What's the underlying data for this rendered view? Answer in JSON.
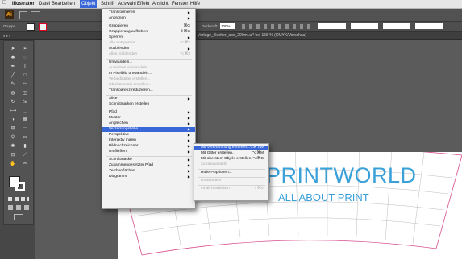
{
  "menubar": {
    "apple": "",
    "items": [
      "Illustrator",
      "Datei",
      "Bearbeiten",
      "Objekt",
      "Schrift",
      "Auswahl",
      "Effekt",
      "Ansicht",
      "Fenster",
      "Hilfe"
    ],
    "active": "Objekt"
  },
  "app": {
    "logo": "Ai"
  },
  "control": {
    "left_label": "Gruppe",
    "deckkraft_label": "Deckkraft:",
    "deckkraft_value": "100%"
  },
  "document_tab": {
    "title": "Vorlage_Becher_abc_290ml.ai* bei 158 % (CMYK/Vorschau)"
  },
  "objekt_menu": [
    {
      "label": "Transformieren",
      "submenu": true
    },
    {
      "label": "Anordnen",
      "submenu": true
    },
    {
      "sep": true
    },
    {
      "label": "Gruppieren",
      "shortcut": "⌘G"
    },
    {
      "label": "Gruppierung aufheben",
      "shortcut": "⇧⌘G"
    },
    {
      "label": "Sperren",
      "submenu": true
    },
    {
      "label": "Alle entsperren",
      "shortcut": "⌥⌘2",
      "disabled": true
    },
    {
      "label": "Ausblenden",
      "submenu": true
    },
    {
      "label": "Alles einblenden",
      "shortcut": "⌥⌘3",
      "disabled": true
    },
    {
      "sep": true
    },
    {
      "label": "Umwandeln..."
    },
    {
      "label": "Aussehen umwandeln",
      "disabled": true
    },
    {
      "label": "In Pixelbild umwandeln..."
    },
    {
      "label": "Verlaufsgitter erstellen...",
      "disabled": true
    },
    {
      "label": "Objektmosaik erstellen...",
      "disabled": true
    },
    {
      "label": "Transparenz reduzieren..."
    },
    {
      "sep": true
    },
    {
      "label": "Slice",
      "submenu": true
    },
    {
      "label": "Schnittmarken erstellen"
    },
    {
      "sep": true
    },
    {
      "label": "Pfad",
      "submenu": true
    },
    {
      "label": "Muster",
      "submenu": true
    },
    {
      "label": "Angleichen",
      "submenu": true
    },
    {
      "label": "Verzerrungshülle",
      "submenu": true,
      "highlight": true
    },
    {
      "label": "Perspektive",
      "submenu": true
    },
    {
      "label": "Interaktiv malen",
      "submenu": true
    },
    {
      "label": "Bildnachzeichner",
      "submenu": true
    },
    {
      "label": "Umfließen",
      "submenu": true
    },
    {
      "sep": true
    },
    {
      "label": "Schnittmaske",
      "submenu": true
    },
    {
      "label": "Zusammengesetzter Pfad",
      "submenu": true
    },
    {
      "label": "Zeichenflächen",
      "submenu": true
    },
    {
      "label": "Diagramm",
      "submenu": true
    }
  ],
  "huelle_submenu": [
    {
      "label": "Mit Verkrümmung erstellen...",
      "shortcut": "⌥⌘⇧W",
      "highlight": true
    },
    {
      "label": "Mit Gitter erstellen...",
      "shortcut": "⌥⌘M"
    },
    {
      "label": "Mit oberstem Objekt erstellen",
      "shortcut": "⌥⌘C"
    },
    {
      "label": "Zurückwandeln",
      "disabled": true
    },
    {
      "sep": true
    },
    {
      "label": "Hüllen-Optionen..."
    },
    {
      "sep": true
    },
    {
      "label": "Umwandeln",
      "disabled": true
    },
    {
      "sep": true
    },
    {
      "label": "Inhalt bearbeiten",
      "shortcut": "⇧⌘V",
      "disabled": true
    }
  ],
  "artwork": {
    "text_main": "PRINTWORLD",
    "text_sub": "ALL ABOUT PRINT"
  },
  "colors": {
    "menu_highlight": "#3a67d8",
    "artwork_text": "#3aa0d8",
    "guide_lines": "#d64f8e"
  }
}
